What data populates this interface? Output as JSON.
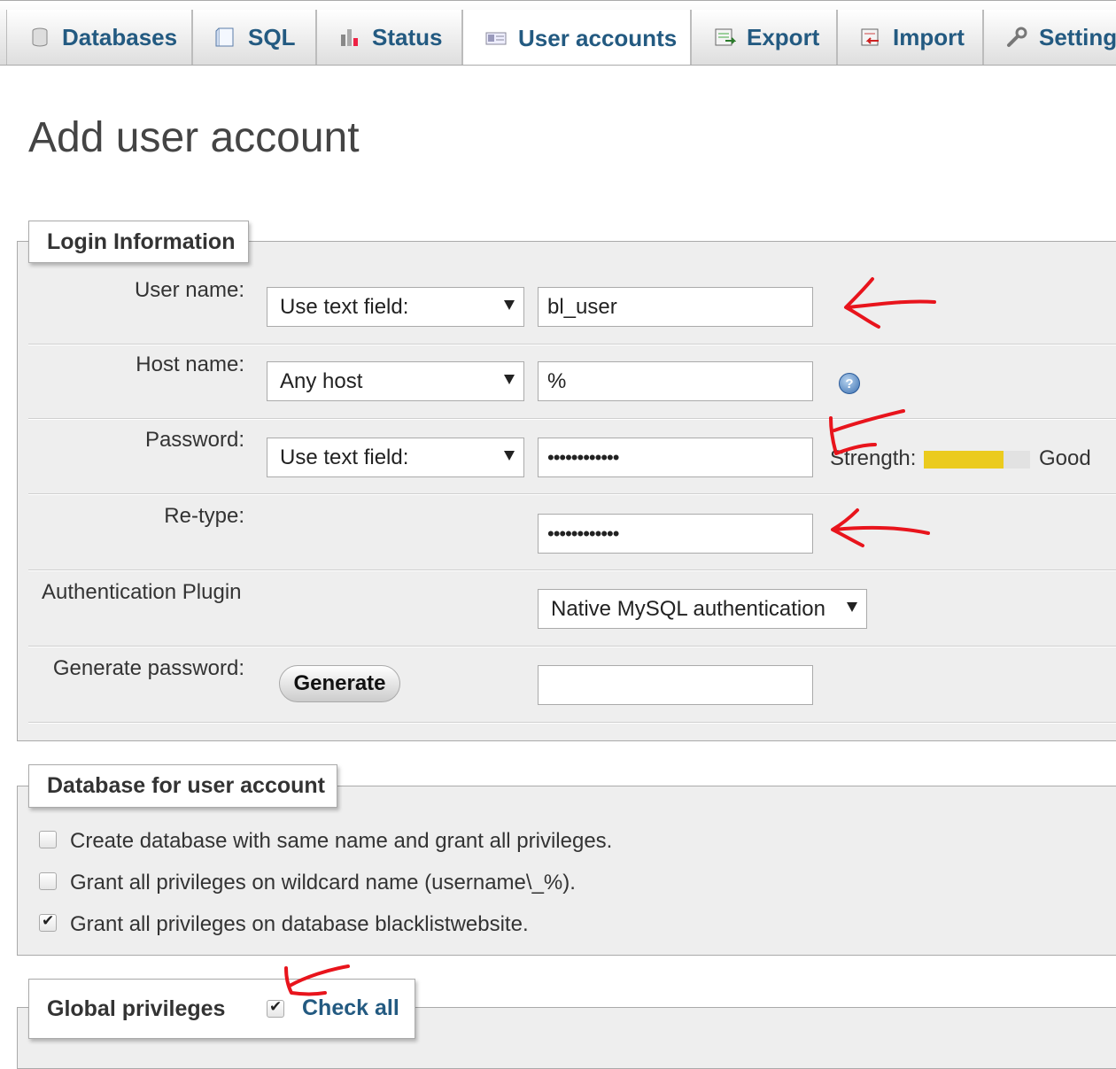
{
  "tabs": [
    {
      "label": "Databases",
      "icon": "database-icon"
    },
    {
      "label": "SQL",
      "icon": "sql-icon"
    },
    {
      "label": "Status",
      "icon": "status-chart-icon"
    },
    {
      "label": "User accounts",
      "icon": "user-accounts-icon",
      "active": true
    },
    {
      "label": "Export",
      "icon": "export-icon"
    },
    {
      "label": "Import",
      "icon": "import-icon"
    },
    {
      "label": "Settings",
      "icon": "wrench-icon"
    }
  ],
  "page_title": "Add user account",
  "login": {
    "legend": "Login Information",
    "user_name": {
      "label": "User name:",
      "select": "Use text field:",
      "value": "bl_user"
    },
    "host_name": {
      "label": "Host name:",
      "select": "Any host",
      "value": "%"
    },
    "password": {
      "label": "Password:",
      "select": "Use text field:",
      "value": "••••••••••••",
      "strength_label": "Strength:",
      "strength_text": "Good",
      "strength_level": 0.75
    },
    "retype": {
      "label": "Re-type:",
      "value": "••••••••••••"
    },
    "auth_plugin": {
      "label": "Authentication Plugin",
      "select": "Native MySQL authentication"
    },
    "generate": {
      "label": "Generate password:",
      "button": "Generate",
      "value": ""
    }
  },
  "database_section": {
    "legend": "Database for user account",
    "options": [
      {
        "label": "Create database with same name and grant all privileges.",
        "checked": false
      },
      {
        "label": "Grant all privileges on wildcard name (username\\_%).",
        "checked": false
      },
      {
        "label": "Grant all privileges on database blacklistwebsite.",
        "checked": true
      }
    ]
  },
  "global_privileges": {
    "legend": "Global privileges",
    "check_all_label": "Check all",
    "check_all_checked": true
  },
  "colors": {
    "tab_text": "#235a81",
    "annotation_arrow": "#e8141c",
    "strength_fill": "#ebcb1e",
    "fieldset_bg": "#eeeeee"
  }
}
